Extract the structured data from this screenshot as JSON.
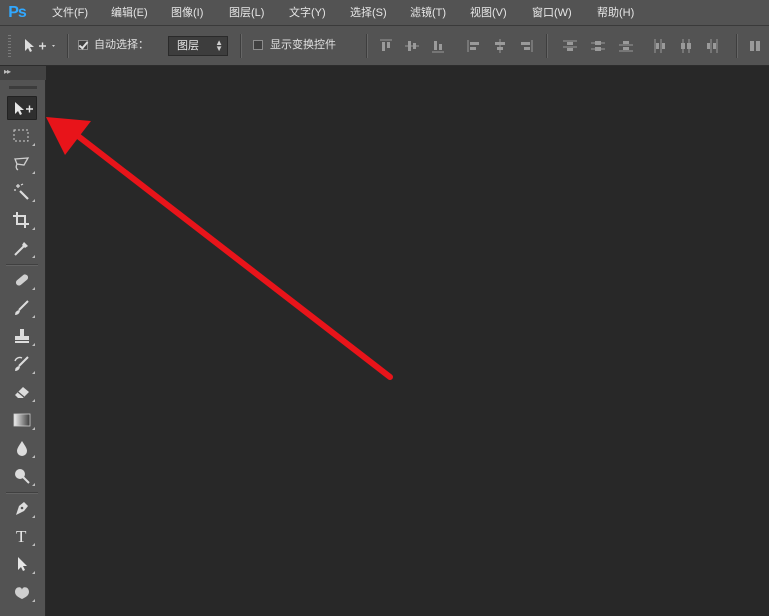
{
  "app": {
    "logo_text": "Ps"
  },
  "menu": [
    {
      "label": "文件(F)"
    },
    {
      "label": "编辑(E)"
    },
    {
      "label": "图像(I)"
    },
    {
      "label": "图层(L)"
    },
    {
      "label": "文字(Y)"
    },
    {
      "label": "选择(S)"
    },
    {
      "label": "滤镜(T)"
    },
    {
      "label": "视图(V)"
    },
    {
      "label": "窗口(W)"
    },
    {
      "label": "帮助(H)"
    }
  ],
  "options_bar": {
    "auto_select": {
      "label": "自动选择：",
      "checked": true
    },
    "auto_select_target": {
      "value": "图层"
    },
    "show_transform_controls": {
      "label": "显示变换控件",
      "checked": false
    }
  },
  "tools": [
    {
      "name": "move-tool",
      "active": true
    },
    {
      "name": "rectangular-marquee-tool"
    },
    {
      "name": "lasso-tool"
    },
    {
      "name": "magic-wand-tool"
    },
    {
      "name": "crop-tool"
    },
    {
      "name": "eyedropper-tool"
    },
    {
      "name": "spot-healing-brush-tool"
    },
    {
      "name": "brush-tool"
    },
    {
      "name": "clone-stamp-tool"
    },
    {
      "name": "history-brush-tool"
    },
    {
      "name": "eraser-tool"
    },
    {
      "name": "gradient-tool"
    },
    {
      "name": "blur-tool"
    },
    {
      "name": "dodge-tool"
    },
    {
      "name": "pen-tool"
    },
    {
      "name": "type-tool",
      "glyph": "T"
    },
    {
      "name": "path-selection-tool"
    },
    {
      "name": "custom-shape-tool"
    }
  ],
  "colors": {
    "chrome": "#535353",
    "canvas": "#282828",
    "logo": "#31a8ff",
    "annotation_arrow": "#e8141a"
  },
  "annotation": {
    "type": "arrow",
    "points_to": "move-tool"
  }
}
